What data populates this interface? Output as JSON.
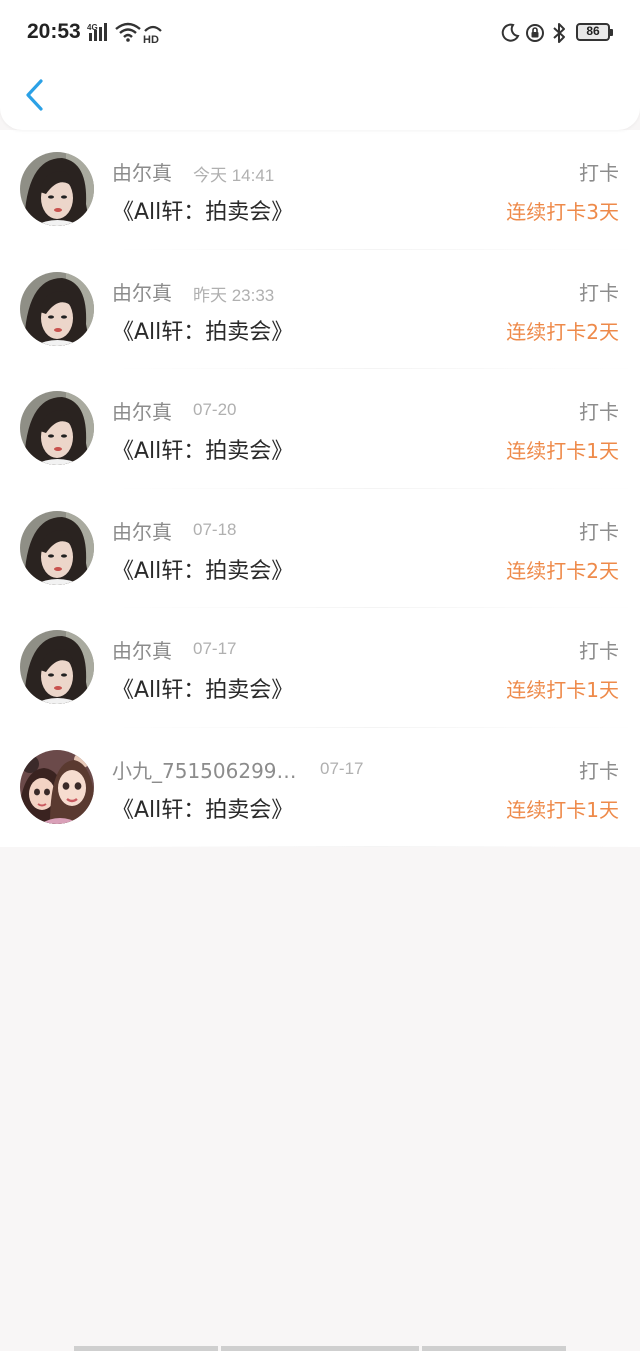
{
  "status_bar": {
    "time": "20:53",
    "network": "4G",
    "hd": "HD",
    "battery": "86",
    "icons": [
      "signal-icon",
      "wifi-icon",
      "hd-icon",
      "moon-icon",
      "rotation-lock-icon",
      "bluetooth-icon",
      "battery-icon"
    ]
  },
  "nav": {
    "back_icon": "chevron-left-icon",
    "accent": "#2ba1e6"
  },
  "colors": {
    "streak": "#ee8a4a",
    "muted": "#8c8c8c",
    "title": "#2a2a2a"
  },
  "list": {
    "items": [
      {
        "name": "由尔真",
        "date": "今天 14:41",
        "title": "《All轩：拍卖会》",
        "action": "打卡",
        "streak": "连续打卡3天",
        "avatar": "photo-avatar"
      },
      {
        "name": "由尔真",
        "date": "昨天 23:33",
        "title": "《All轩：拍卖会》",
        "action": "打卡",
        "streak": "连续打卡2天",
        "avatar": "photo-avatar"
      },
      {
        "name": "由尔真",
        "date": "07-20",
        "title": "《All轩：拍卖会》",
        "action": "打卡",
        "streak": "连续打卡1天",
        "avatar": "photo-avatar"
      },
      {
        "name": "由尔真",
        "date": "07-18",
        "title": "《All轩：拍卖会》",
        "action": "打卡",
        "streak": "连续打卡2天",
        "avatar": "photo-avatar"
      },
      {
        "name": "由尔真",
        "date": "07-17",
        "title": "《All轩：拍卖会》",
        "action": "打卡",
        "streak": "连续打卡1天",
        "avatar": "photo-avatar"
      },
      {
        "name": "小九_7515062998...",
        "date": "07-17",
        "title": "《All轩：拍卖会》",
        "action": "打卡",
        "streak": "连续打卡1天",
        "avatar": "cartoon-avatar"
      }
    ]
  }
}
